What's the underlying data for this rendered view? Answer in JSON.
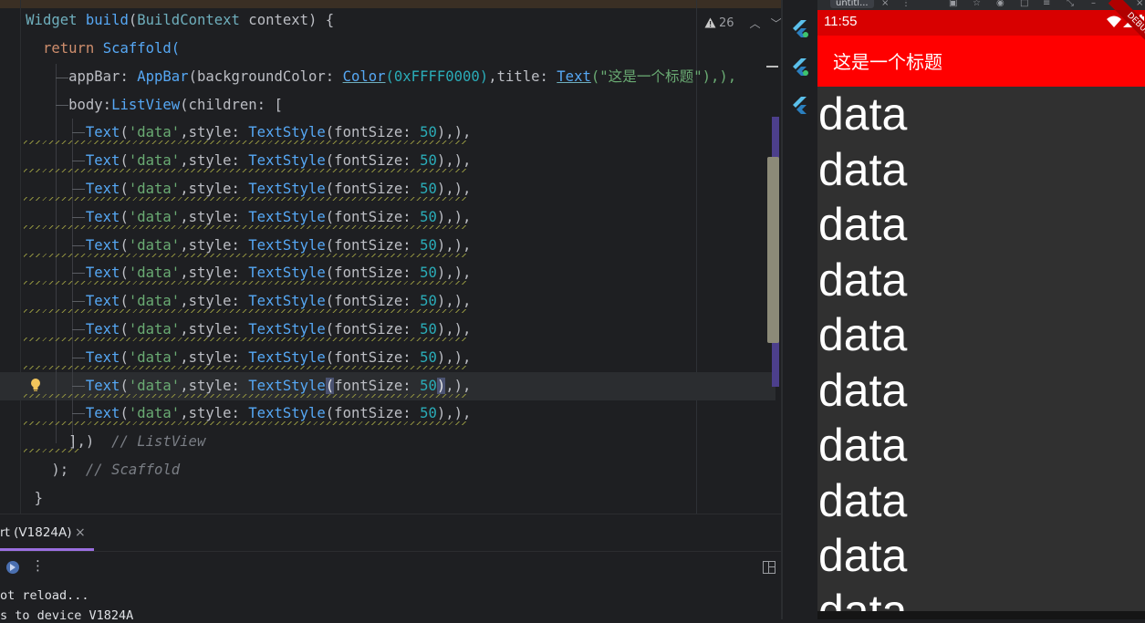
{
  "editor": {
    "warning_count": "26",
    "lines": {
      "l1": "  Widget build(BuildContext context) {",
      "return": "return",
      "scaffold": "Scaffold(",
      "appbar_prop": "appBar: ",
      "appbar_cls": "AppBar",
      "bg_prop": "(backgroundColor: ",
      "color_cls": "Color",
      "color_val": "(0xFFFF0000)",
      "title_prop": ",title: ",
      "text_cls": "Text",
      "title_str": "(\"这是一个标题\"),),",
      "body_prop": "body:",
      "listview_cls": "ListView",
      "children": "(children: [",
      "item_text": "Text",
      "item_str": "('data'",
      "item_style": ",style: ",
      "item_ts": "TextStyle",
      "item_fs": "(fontSize: ",
      "item_num": "50",
      "item_end": "),),",
      "close_list": "],)",
      "close_list_cm": "// ListView",
      "close_scaffold": ");",
      "close_scaffold_cm": "// Scaffold",
      "close_brace": "}"
    }
  },
  "bottom_panel": {
    "tab_label": "rt (V1824A)",
    "tab_close": "×",
    "console": [
      "ot reload...",
      "s to device V1824A"
    ]
  },
  "window": {
    "tab_label": "untitl..."
  },
  "phone": {
    "time": "11:55",
    "app_title": "这是一个标题",
    "debug_banner": "DEBUG",
    "items": [
      "data",
      "data",
      "data",
      "data",
      "data",
      "data",
      "data",
      "data",
      "data",
      "data"
    ],
    "colors": {
      "app_bar": "#FF0000",
      "status_bar": "#D80000",
      "body": "#303030",
      "text": "#FFFFFF"
    }
  },
  "icons": {
    "warning": "warning-triangle-icon",
    "flutter": "flutter-icon",
    "bulb": "lightbulb-icon"
  }
}
